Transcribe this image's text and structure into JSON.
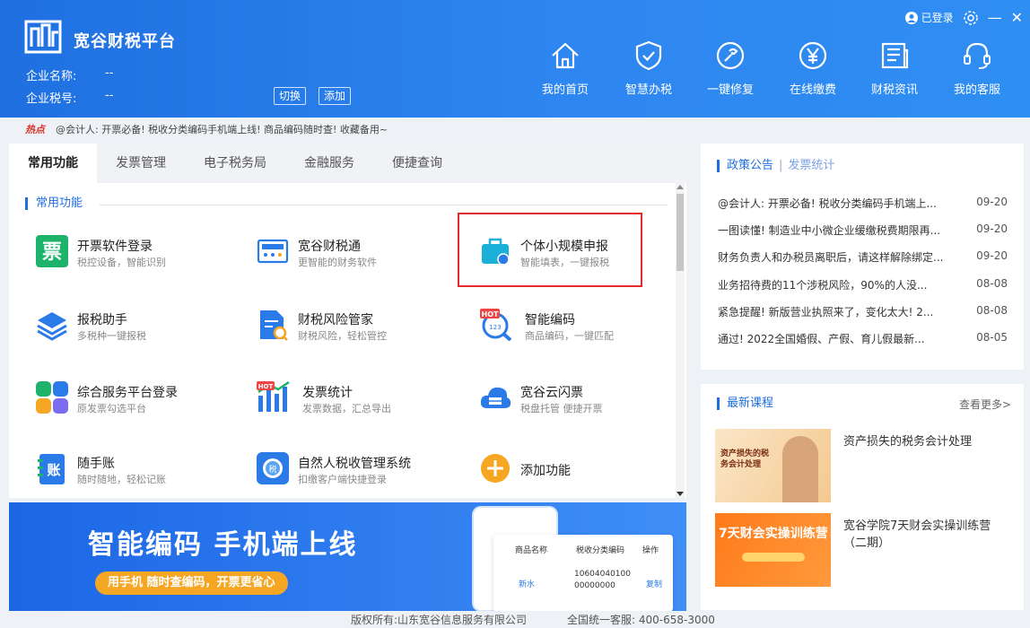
{
  "app": {
    "title": "宽谷财税平台",
    "company_label": "企业名称:",
    "company_value": "--",
    "taxno_label": "企业税号:",
    "taxno_value": "--",
    "switch_label": "切换",
    "add_label": "添加",
    "login_status": "已登录",
    "minimize": "—",
    "close": "✕"
  },
  "nav": [
    {
      "label": "我的首页",
      "icon": "home-icon"
    },
    {
      "label": "智慧办税",
      "icon": "shield-check-icon"
    },
    {
      "label": "一键修复",
      "icon": "repair-icon"
    },
    {
      "label": "在线缴费",
      "icon": "yen-icon"
    },
    {
      "label": "财税资讯",
      "icon": "news-icon"
    },
    {
      "label": "我的客服",
      "icon": "headset-icon"
    }
  ],
  "ticker": {
    "hot": "热点",
    "text": "@会计人: 开票必备! 税收分类编码手机端上线! 商品编码随时查! 收藏备用~"
  },
  "tabs": [
    "常用功能",
    "发票管理",
    "电子税务局",
    "金融服务",
    "便捷查询"
  ],
  "section_title": "常用功能",
  "functions": [
    {
      "name": "开票软件登录",
      "desc": "税控设备，智能识别",
      "icon": "invoice-icon",
      "color": "#1db36b"
    },
    {
      "name": "宽谷财税通",
      "desc": "更智能的财务软件",
      "icon": "calculator-icon",
      "color": "#2a7be8"
    },
    {
      "name": "个体小规模申报",
      "desc": "智能填表，一键报税",
      "icon": "briefcase-icon",
      "color": "#1bb0d8"
    },
    {
      "name": "报税助手",
      "desc": "多税种一键报税",
      "icon": "layers-icon",
      "color": "#2a7be8"
    },
    {
      "name": "财税风险管家",
      "desc": "财税风险，轻松管控",
      "icon": "risk-doc-icon",
      "color": "#2a7be8"
    },
    {
      "name": "智能编码",
      "desc": "商品编码，一键匹配",
      "icon": "smart-code-icon",
      "color": "#2a7be8"
    },
    {
      "name": "综合服务平台登录",
      "desc": "原发票勾选平台",
      "icon": "grid-icon",
      "color": "#2a7be8"
    },
    {
      "name": "发票统计",
      "desc": "发票数据，汇总导出",
      "icon": "bar-chart-icon",
      "color": "#2a7be8"
    },
    {
      "name": "宽谷云闪票",
      "desc": "税盘托管 便捷开票",
      "icon": "cloud-icon",
      "color": "#2a7be8"
    },
    {
      "name": "随手账",
      "desc": "随时随地，轻松记账",
      "icon": "ledger-icon",
      "color": "#2a7be8"
    },
    {
      "name": "自然人税收管理系统",
      "desc": "扣缴客户端快捷登录",
      "icon": "tax-system-icon",
      "color": "#2a7be8"
    },
    {
      "name": "添加功能",
      "desc": "",
      "icon": "add-circle-icon",
      "color": "#f5a623"
    }
  ],
  "hot_badge": "HOT",
  "banner": {
    "title": "智能编码 手机端上线",
    "button": "用手机 随时查编码，开票更省心",
    "table_header": [
      "商品名称",
      "税收分类编码",
      "操作"
    ],
    "table_row": [
      "新水",
      "10604040100 00000000",
      "复制"
    ]
  },
  "policy": {
    "tab_active": "政策公告",
    "tab_other": "发票统计",
    "items": [
      {
        "title": "@会计人: 开票必备! 税收分类编码手机端上...",
        "date": "09-20"
      },
      {
        "title": "一图读懂! 制造业中小微企业缓缴税费期限再...",
        "date": "09-20"
      },
      {
        "title": "财务负责人和办税员离职后，请这样解除绑定...",
        "date": "09-20"
      },
      {
        "title": "业务招待费的11个涉税风险，90%的人没...",
        "date": "08-08"
      },
      {
        "title": "紧急提醒! 新版营业执照来了，变化太大! 2...",
        "date": "08-08"
      },
      {
        "title": "通过! 2022全国婚假、产假、育儿假最新...",
        "date": "08-05"
      }
    ]
  },
  "courses": {
    "title": "最新课程",
    "more": "查看更多>",
    "items": [
      {
        "name": "资产损失的税务会计处理",
        "thumb_text": "资产损失的税务会计处理"
      },
      {
        "name": "宽谷学院7天财会实操训练营（二期）",
        "thumb_text": "7天财会实操训练营"
      }
    ]
  },
  "footer": {
    "copyright": "版权所有:山东宽谷信息服务有限公司",
    "hotline": "全国统一客服: 400-658-3000"
  },
  "colors": {
    "primary": "#1f6fe0",
    "highlight": "#e42b2b",
    "accent": "#f5a623",
    "hot": "#d8322a"
  }
}
